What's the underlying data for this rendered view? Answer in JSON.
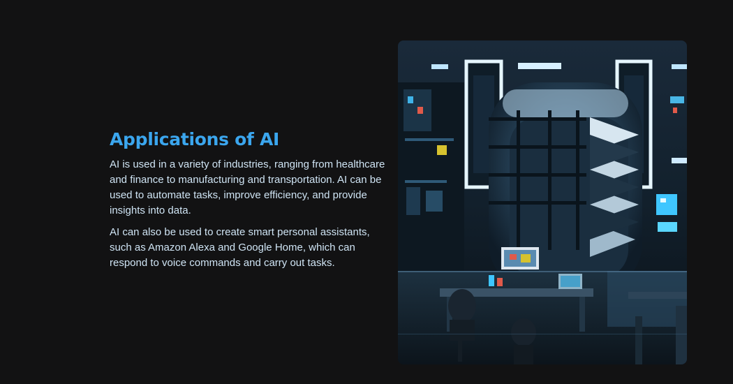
{
  "section": {
    "title": "Applications of AI",
    "paragraphs": [
      "AI is used in a variety of industries, ranging from healthcare and finance to manufacturing and transportation. AI can be used to automate tasks, improve efficiency, and provide insights into data.",
      "AI can also be used to create smart personal assistants, such as Amazon Alexa and Google Home, which can respond to voice commands and carry out tasks."
    ]
  },
  "image": {
    "subject": "futuristic-ai-lab-illustration"
  },
  "colors": {
    "background": "#121213",
    "title": "#3ba6ee",
    "body_text": "#cfe4f4",
    "accent_glow": "#bfe6ff"
  }
}
